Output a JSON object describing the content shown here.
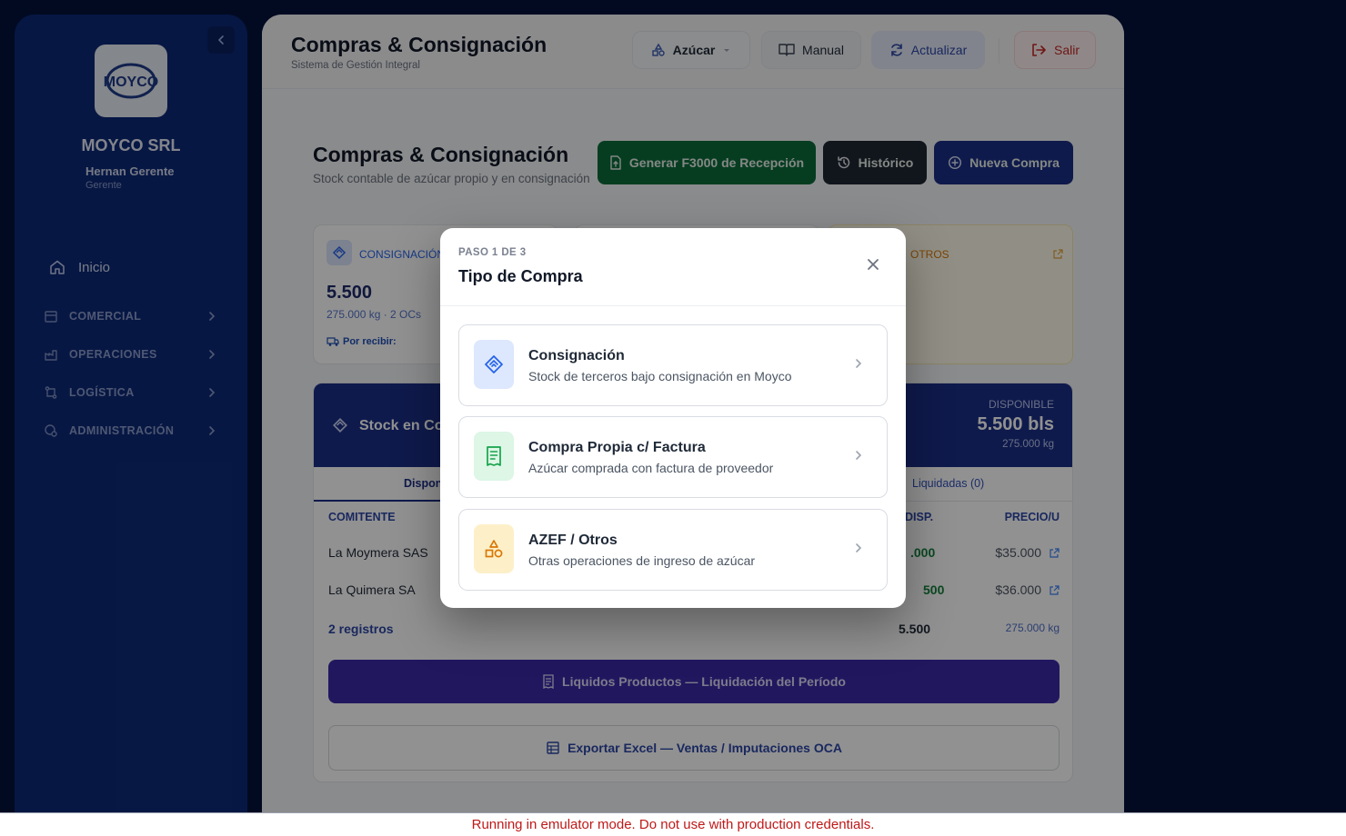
{
  "sidebar": {
    "logo_text": "MOYCO",
    "company": "MOYCO SRL",
    "user_name": "Hernan Gerente",
    "user_role": "Gerente",
    "home_label": "Inicio",
    "groups": [
      {
        "label": "COMERCIAL",
        "icon": "store-icon"
      },
      {
        "label": "OPERACIONES",
        "icon": "factory-icon"
      },
      {
        "label": "LOGÍSTICA",
        "icon": "route-icon"
      },
      {
        "label": "ADMINISTRACIÓN",
        "icon": "admin-icon"
      }
    ]
  },
  "header": {
    "title": "Compras & Consignación",
    "subtitle": "Sistema de Gestión Integral",
    "product_select": "Azúcar",
    "manual_label": "Manual",
    "refresh_label": "Actualizar",
    "logout_label": "Salir"
  },
  "page": {
    "title": "Compras & Consignación",
    "subtitle": "Stock contable de azúcar propio y en consignación",
    "btn_f3000": "Generar F3000 de Recepción",
    "btn_historico": "Histórico",
    "btn_nueva": "Nueva Compra"
  },
  "cards": {
    "consignacion": {
      "label": "CONSIGNACIÓN",
      "value": "5.500",
      "detail": "275.000 kg · 2 OCs",
      "pending": "Por recibir:"
    },
    "otros": {
      "label": "OTROS"
    }
  },
  "stock": {
    "title": "Stock en Co",
    "available_label": "DISPONIBLE",
    "available_value": "5.500 bls",
    "available_kg": "275.000 kg",
    "tab_active": "Dispon",
    "tab_liquidadas": "Liquidadas (0)",
    "col_comitente": "COMITENTE",
    "col_disp": "DISP.",
    "col_precio": "PRECIO/U",
    "rows": [
      {
        "comitente": "La Moymera SAS",
        "disp": ".000",
        "precio": "$35.000"
      },
      {
        "comitente": "La Quimera SA",
        "disp": "500",
        "precio": "$36.000"
      }
    ],
    "total_label": "2 registros",
    "total_disp": "5.500",
    "total_kg": "275.000 kg",
    "btn_liquidos": "Liquidos Productos — Liquidación del Período",
    "btn_export": "Exportar Excel — Ventas / Imputaciones OCA"
  },
  "modal": {
    "step": "PASO 1 DE 3",
    "title": "Tipo de Compra",
    "options": [
      {
        "title": "Consignación",
        "desc": "Stock de terceros bajo consignación en Moyco",
        "icon": "handshake-icon",
        "color": "#2563eb"
      },
      {
        "title": "Compra Propia c/ Factura",
        "desc": "Azúcar comprada con factura de proveedor",
        "icon": "receipt-icon",
        "color": "#16a34a"
      },
      {
        "title": "AZEF / Otros",
        "desc": "Otras operaciones de ingreso de azúcar",
        "icon": "shapes-icon",
        "color": "#d97706"
      }
    ]
  },
  "banner": {
    "text": "Running in emulator mode. Do not use with production credentials."
  }
}
